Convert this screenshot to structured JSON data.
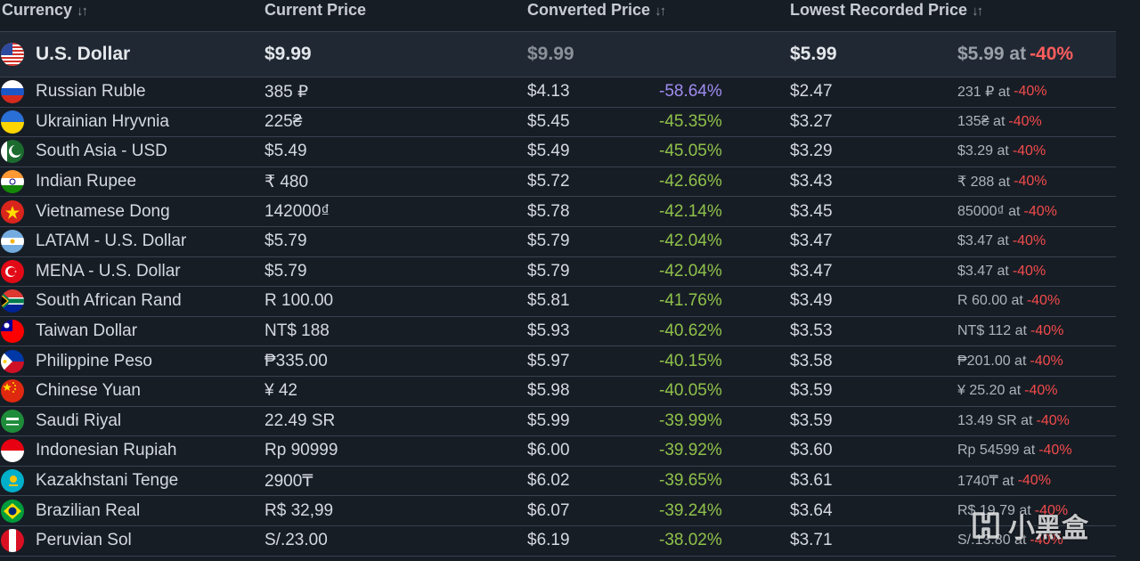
{
  "header": {
    "currency": "Currency",
    "current_price": "Current Price",
    "converted_price": "Converted Price",
    "lowest_recorded_price": "Lowest Recorded Price",
    "sort_icon": "sort-icon"
  },
  "colors": {
    "background": "#171d25",
    "row_highlight": "#202833",
    "discount_green": "#8fc14a",
    "discount_purple": "#9f8cf2",
    "percent_red": "#f24b4b"
  },
  "rows": [
    {
      "flag": "us",
      "name": "U.S. Dollar",
      "price": "$9.99",
      "converted": "$9.99",
      "diff": "",
      "lowest": "$5.99",
      "record_value": "$5.99 at",
      "record_pct": "-40%"
    },
    {
      "flag": "ru",
      "name": "Russian Ruble",
      "price": "385 ₽",
      "converted": "$4.13",
      "diff": "-58.64%",
      "lowest": "$2.47",
      "record_value": "231 ₽ at",
      "record_pct": "-40%"
    },
    {
      "flag": "ua",
      "name": "Ukrainian Hryvnia",
      "price": "225₴",
      "converted": "$5.45",
      "diff": "-45.35%",
      "lowest": "$3.27",
      "record_value": "135₴ at",
      "record_pct": "-40%"
    },
    {
      "flag": "pk",
      "name": "South Asia - USD",
      "price": "$5.49",
      "converted": "$5.49",
      "diff": "-45.05%",
      "lowest": "$3.29",
      "record_value": "$3.29 at",
      "record_pct": "-40%"
    },
    {
      "flag": "in",
      "name": "Indian Rupee",
      "price": "₹ 480",
      "converted": "$5.72",
      "diff": "-42.66%",
      "lowest": "$3.43",
      "record_value": "₹ 288 at",
      "record_pct": "-40%"
    },
    {
      "flag": "vn",
      "name": "Vietnamese Dong",
      "price": "142000₫",
      "converted": "$5.78",
      "diff": "-42.14%",
      "lowest": "$3.45",
      "record_value": "85000₫ at",
      "record_pct": "-40%"
    },
    {
      "flag": "ar",
      "name": "LATAM - U.S. Dollar",
      "price": "$5.79",
      "converted": "$5.79",
      "diff": "-42.04%",
      "lowest": "$3.47",
      "record_value": "$3.47 at",
      "record_pct": "-40%"
    },
    {
      "flag": "tr",
      "name": "MENA - U.S. Dollar",
      "price": "$5.79",
      "converted": "$5.79",
      "diff": "-42.04%",
      "lowest": "$3.47",
      "record_value": "$3.47 at",
      "record_pct": "-40%"
    },
    {
      "flag": "za",
      "name": "South African Rand",
      "price": "R 100.00",
      "converted": "$5.81",
      "diff": "-41.76%",
      "lowest": "$3.49",
      "record_value": "R 60.00 at",
      "record_pct": "-40%"
    },
    {
      "flag": "tw",
      "name": "Taiwan Dollar",
      "price": "NT$ 188",
      "converted": "$5.93",
      "diff": "-40.62%",
      "lowest": "$3.53",
      "record_value": "NT$ 112 at",
      "record_pct": "-40%"
    },
    {
      "flag": "ph",
      "name": "Philippine Peso",
      "price": "₱335.00",
      "converted": "$5.97",
      "diff": "-40.15%",
      "lowest": "$3.58",
      "record_value": "₱201.00 at",
      "record_pct": "-40%"
    },
    {
      "flag": "cn",
      "name": "Chinese Yuan",
      "price": "¥ 42",
      "converted": "$5.98",
      "diff": "-40.05%",
      "lowest": "$3.59",
      "record_value": "¥ 25.20 at",
      "record_pct": "-40%"
    },
    {
      "flag": "sa",
      "name": "Saudi Riyal",
      "price": "22.49 SR",
      "converted": "$5.99",
      "diff": "-39.99%",
      "lowest": "$3.59",
      "record_value": "13.49 SR at",
      "record_pct": "-40%"
    },
    {
      "flag": "id",
      "name": "Indonesian Rupiah",
      "price": "Rp 90999",
      "converted": "$6.00",
      "diff": "-39.92%",
      "lowest": "$3.60",
      "record_value": "Rp 54599 at",
      "record_pct": "-40%"
    },
    {
      "flag": "kz",
      "name": "Kazakhstani Tenge",
      "price": "2900₸",
      "converted": "$6.02",
      "diff": "-39.65%",
      "lowest": "$3.61",
      "record_value": "1740₸ at",
      "record_pct": "-40%"
    },
    {
      "flag": "br",
      "name": "Brazilian Real",
      "price": "R$ 32,99",
      "converted": "$6.07",
      "diff": "-39.24%",
      "lowest": "$3.64",
      "record_value": "R$ 19.79 at",
      "record_pct": "-40%"
    },
    {
      "flag": "pe",
      "name": "Peruvian Sol",
      "price": "S/.23.00",
      "converted": "$6.19",
      "diff": "-38.02%",
      "lowest": "$3.71",
      "record_value": "S/.13.80 at",
      "record_pct": "-40%"
    }
  ],
  "watermark": {
    "text": "小黑盒",
    "icon": "xiaoheihe-logo-icon"
  }
}
